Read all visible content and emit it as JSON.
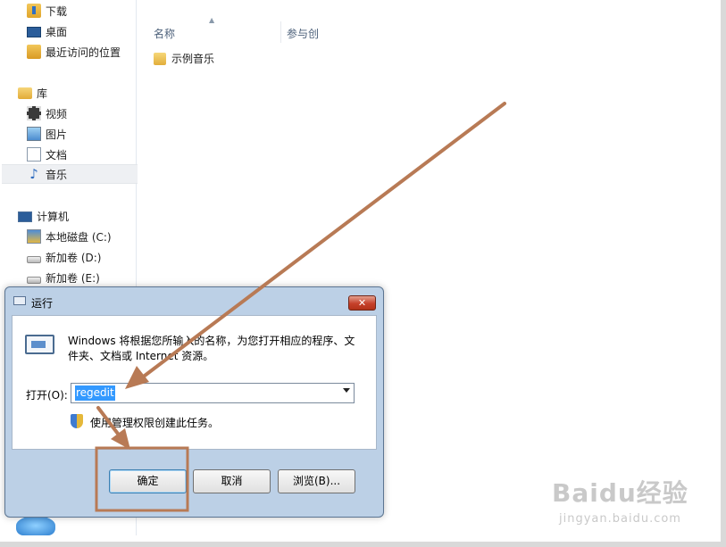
{
  "nav": {
    "items": [
      {
        "label": "下载",
        "icon": "download-folder-icon"
      },
      {
        "label": "桌面",
        "icon": "desktop-icon"
      },
      {
        "label": "最近访问的位置",
        "icon": "recent-places-icon"
      },
      {
        "label": "库",
        "icon": "library-icon"
      },
      {
        "label": "视频",
        "icon": "video-library-icon"
      },
      {
        "label": "图片",
        "icon": "picture-library-icon"
      },
      {
        "label": "文档",
        "icon": "document-library-icon"
      },
      {
        "label": "音乐",
        "icon": "music-library-icon"
      },
      {
        "label": "计算机",
        "icon": "computer-icon"
      },
      {
        "label": "本地磁盘 (C:)",
        "icon": "system-drive-icon"
      },
      {
        "label": "新加卷 (D:)",
        "icon": "drive-icon"
      },
      {
        "label": "新加卷 (E:)",
        "icon": "drive-icon"
      }
    ],
    "selected": "音乐"
  },
  "content": {
    "columns": {
      "name": "名称",
      "contributing_artists": "参与创"
    },
    "files": [
      {
        "name": "示例音乐",
        "icon": "folder-icon"
      }
    ]
  },
  "run_dialog": {
    "title": "运行",
    "description": "Windows 将根据您所输入的名称，为您打开相应的程序、文件夹、文档或 Internet 资源。",
    "open_label": "打开(O):",
    "open_value": "regedit",
    "admin_note": "使用管理权限创建此任务。",
    "buttons": {
      "ok": "确定",
      "cancel": "取消",
      "browse": "浏览(B)..."
    },
    "close_label": "✕"
  },
  "annotations": {
    "arrow_color": "#b87a55",
    "highlight_color": "#b87a55"
  },
  "watermark": {
    "logo": "Baidu经验",
    "sub": "jingyan.baidu.com"
  }
}
